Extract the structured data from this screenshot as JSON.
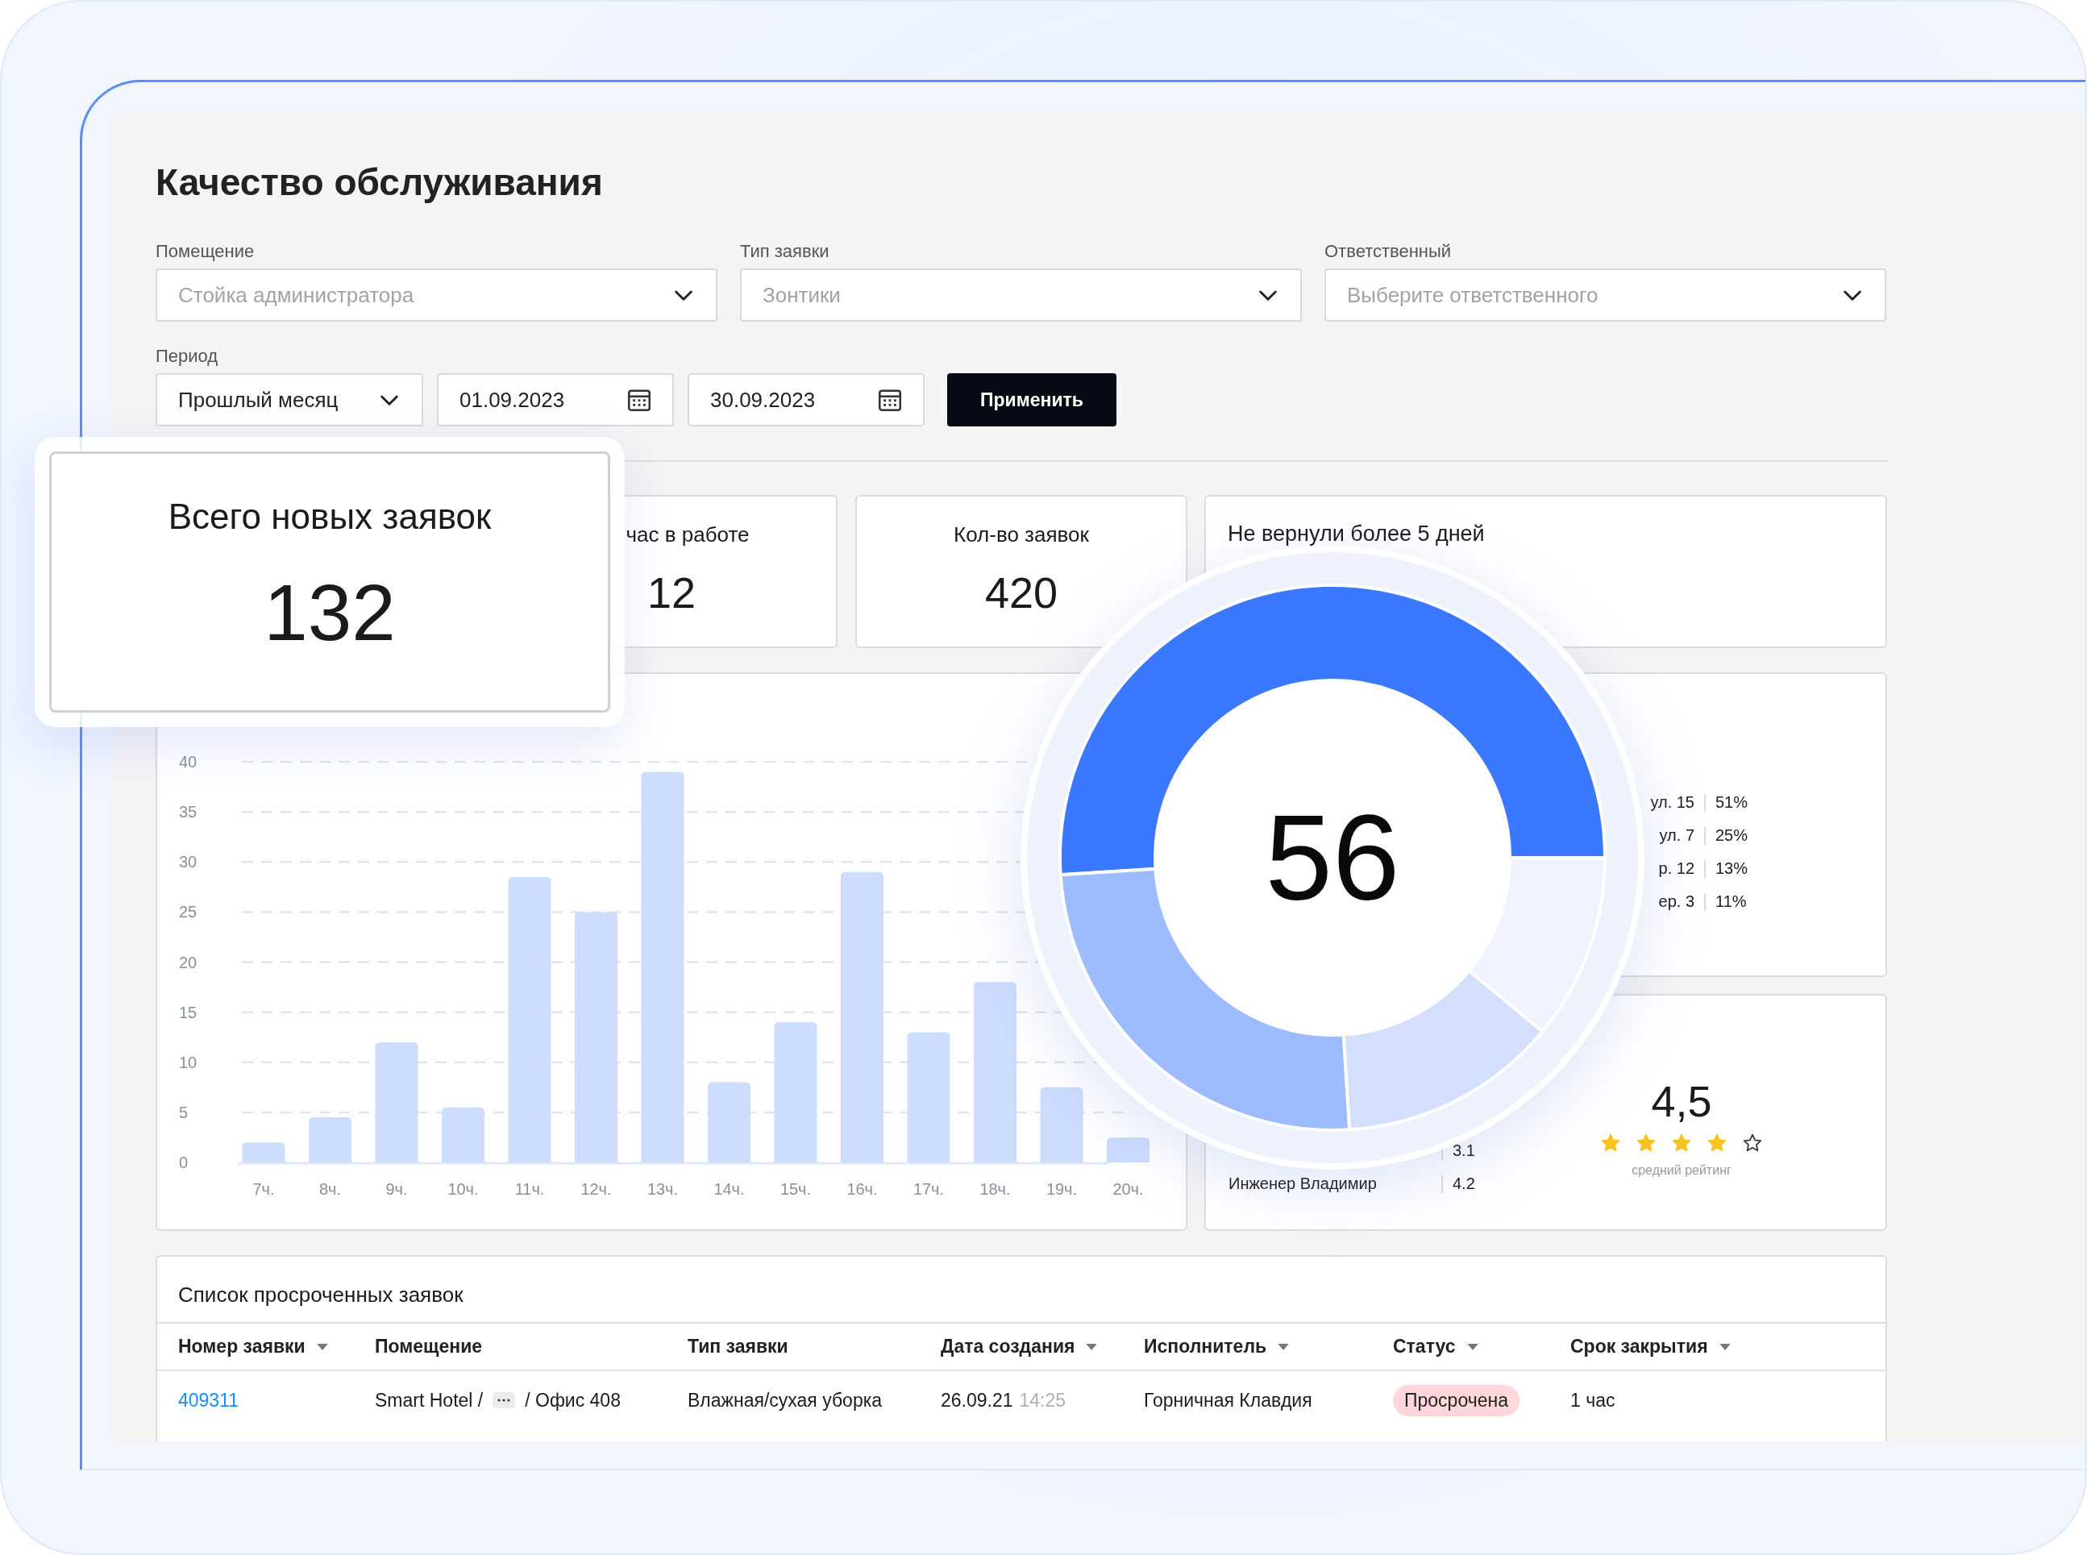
{
  "page": {
    "title": "Качество обслуживания"
  },
  "filters": [
    {
      "label": "Помещение",
      "placeholder": "Стойка администратора"
    },
    {
      "label": "Тип заявки",
      "placeholder": "Зонтики"
    },
    {
      "label": "Ответственный",
      "placeholder": "Выберите ответственного"
    }
  ],
  "period": {
    "label": "Период",
    "value": "Прошлый месяц",
    "date_from": "01.09.2023",
    "date_to": "30.09.2023",
    "apply_button": "Применить"
  },
  "kpis": [
    {
      "title": "час в работе",
      "value": "12"
    },
    {
      "title": "Кол-во заявок",
      "value": "420"
    }
  ],
  "overdue_card": {
    "title": "Не вернули более 5 дней"
  },
  "hours_chart": {
    "chart_data": {
      "type": "bar",
      "categories": [
        "7ч.",
        "8ч.",
        "9ч.",
        "10ч.",
        "11ч.",
        "12ч.",
        "13ч.",
        "14ч.",
        "15ч.",
        "16ч.",
        "17ч.",
        "18ч.",
        "19ч.",
        "20ч."
      ],
      "series": [
        {
          "color": "#cddcff",
          "values": [
            2,
            4.5,
            12,
            5.5,
            28.5,
            25,
            39,
            8,
            14,
            29,
            13,
            18,
            7.5,
            2.5
          ]
        }
      ],
      "ylim": [
        0,
        40
      ],
      "yticks": [
        0,
        5,
        10,
        15,
        20,
        25,
        30,
        35,
        40
      ],
      "grid": true
    }
  },
  "location_legend": [
    {
      "label": "ул. 15",
      "share": "51%"
    },
    {
      "label": "ул. 7",
      "share": "25%"
    },
    {
      "label": "р. 12",
      "share": "13%"
    },
    {
      "label": "ер. 3",
      "share": "11%"
    }
  ],
  "rating": {
    "rows": [
      {
        "value": "3.1"
      },
      {
        "name": "Инженер Владимир",
        "value": "4.2"
      }
    ],
    "score": "4,5",
    "stars": 4,
    "caption": "средний рейтинг"
  },
  "overdue_table": {
    "title": "Список просроченных заявок",
    "columns": [
      {
        "label": "Номер заявки",
        "sortable": true
      },
      {
        "label": "Помещение",
        "sortable": false
      },
      {
        "label": "Тип заявки",
        "sortable": false
      },
      {
        "label": "Дата создания",
        "sortable": true
      },
      {
        "label": "Исполнитель",
        "sortable": true
      },
      {
        "label": "Статус",
        "sortable": true
      },
      {
        "label": "Срок закрытия",
        "sortable": true
      }
    ],
    "rows": [
      {
        "number": "409311",
        "room_start": "Smart Hotel /",
        "room_end": "/ Офис 408",
        "type": "Влажная/сухая уборка",
        "date": "26.09.21",
        "time": "14:25",
        "assignee": "Горничная Клавдия",
        "status": "Просрочена",
        "deadline": "1 час"
      }
    ]
  },
  "highlight_card": {
    "title": "Всего новых заявок",
    "value": "132"
  },
  "donut_callout": {
    "value": "56",
    "chart_data": {
      "type": "donut",
      "values": [
        51,
        25,
        13,
        11
      ]
    }
  }
}
